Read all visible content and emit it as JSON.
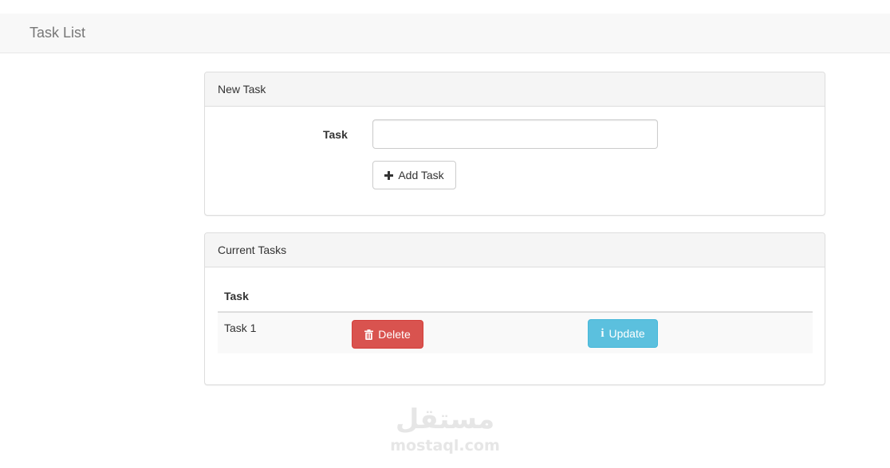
{
  "navbar": {
    "brand": "Task List"
  },
  "new_task_panel": {
    "heading": "New Task",
    "task_label": "Task",
    "task_input": {
      "value": "",
      "placeholder": ""
    },
    "add_button_label": "Add Task",
    "add_button_icon": "plus-icon"
  },
  "current_tasks_panel": {
    "heading": "Current Tasks",
    "columns": [
      "Task"
    ],
    "rows": [
      {
        "name": "Task 1",
        "delete_label": "Delete",
        "delete_icon": "trash-icon",
        "update_label": "Update",
        "update_icon": "info-icon"
      }
    ]
  },
  "watermark": {
    "logo": "مستقل",
    "domain": "mostaql.com"
  },
  "colors": {
    "navbar_bg": "#f8f8f8",
    "panel_heading_bg": "#f5f5f5",
    "danger": "#d9534f",
    "info": "#5bc0de",
    "row_stripe": "#f9f9f9"
  }
}
